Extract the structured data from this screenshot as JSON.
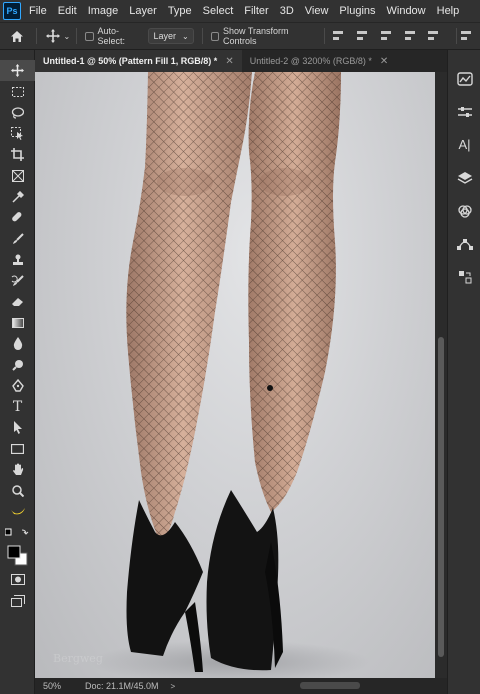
{
  "app": {
    "logo_text": "Ps"
  },
  "menu": [
    "File",
    "Edit",
    "Image",
    "Layer",
    "Type",
    "Select",
    "Filter",
    "3D",
    "View",
    "Plugins",
    "Window",
    "Help"
  ],
  "options_bar": {
    "auto_select_label": "Auto-Select:",
    "auto_select_value": "Layer",
    "show_transform_label": "Show Transform Controls"
  },
  "tabs": [
    {
      "label": "Untitled-1 @ 50% (Pattern Fill 1, RGB/8) *",
      "active": true
    },
    {
      "label": "Untitled-2 @ 3200% (RGB/8) *",
      "active": false
    }
  ],
  "status": {
    "zoom": "50%",
    "doc": "Doc: 21.1M/45.0M",
    "arrow": ">"
  },
  "watermark": "Bergweg",
  "tools": [
    "move-tool",
    "marquee-tool",
    "lasso-tool",
    "object-select-tool",
    "crop-tool",
    "frame-tool",
    "eyedropper-tool",
    "healing-brush-tool",
    "brush-tool",
    "clone-stamp-tool",
    "history-brush-tool",
    "eraser-tool",
    "gradient-tool",
    "blur-tool",
    "dodge-tool",
    "pen-tool",
    "type-tool",
    "path-selection-tool",
    "rectangle-tool",
    "hand-tool",
    "zoom-tool",
    "banana-tool"
  ],
  "panel_icons": [
    "color-panel-icon",
    "adjustments-panel-icon",
    "character-panel-icon",
    "layers-panel-icon",
    "channels-panel-icon",
    "paths-panel-icon",
    "history-panel-icon"
  ],
  "colors": {
    "menubar": "#323232",
    "canvas_bg": "#cfd0d3",
    "skin": "#c8a089",
    "shoe": "#111111"
  }
}
